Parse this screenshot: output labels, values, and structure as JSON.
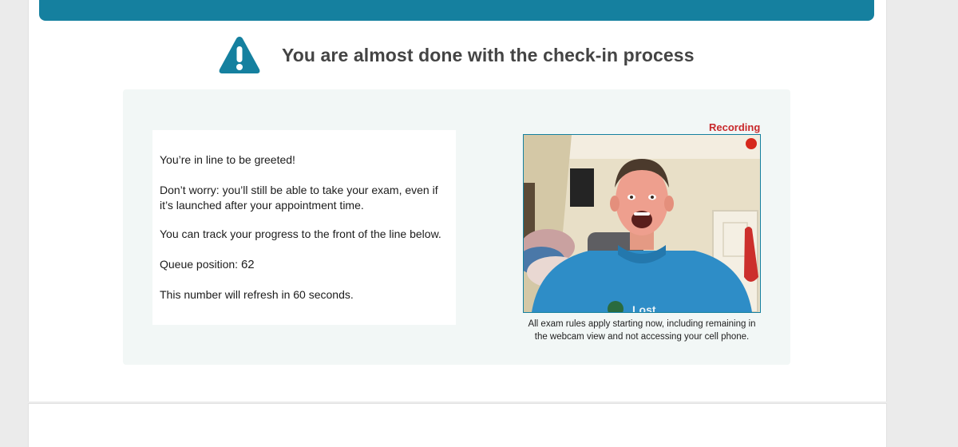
{
  "header": {
    "title": "You are almost done with the check-in process",
    "icon": "warning-icon",
    "accent_color": "#15809f"
  },
  "message": {
    "greeting": "You’re in line to be greeted!",
    "reassurance": "Don’t worry: you’ll still be able to take your exam, even if it’s launched after your appointment time.",
    "progress_note": "You can track your progress to the front of the line below.",
    "queue_label": "Queue position:",
    "queue_position": "62",
    "refresh_note": "This number will refresh in 60 seconds."
  },
  "webcam": {
    "recording_label": "Recording",
    "recording_color": "#c8282b",
    "shirt_text": "Lost",
    "caption": "All exam rules apply starting now, including remaining in the webcam view and not accessing your cell phone."
  }
}
